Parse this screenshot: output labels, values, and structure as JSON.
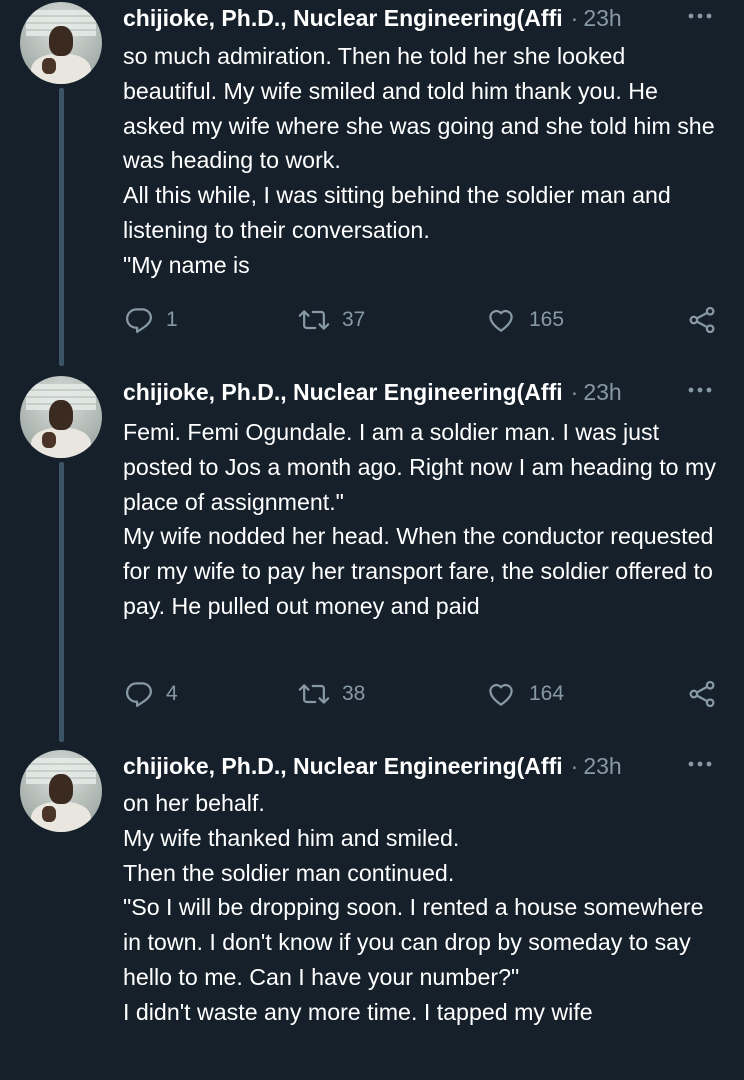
{
  "tweets": [
    {
      "author": "chijioke, Ph.D., Nuclear Engineering(Affi",
      "separator": "·",
      "time": "23h",
      "lines": [
        "so much admiration. Then he told her she looked beautiful. My wife smiled and told him thank you. He asked my wife where she was going and she told him she was heading to work.",
        "All this while, I was sitting behind the soldier man and listening to their conversation.",
        "\"My name is"
      ],
      "replies": "1",
      "retweets": "37",
      "likes": "165"
    },
    {
      "author": "chijioke, Ph.D., Nuclear Engineering(Affi",
      "separator": "·",
      "time": "23h",
      "lines": [
        "Femi. Femi Ogundale. I am a soldier man. I was just posted to Jos a month ago. Right now I am heading to my place of assignment.\"",
        "My wife nodded her head. When the conductor requested for my wife to pay her transport fare, the soldier offered to pay. He pulled out money and paid"
      ],
      "replies": "4",
      "retweets": "38",
      "likes": "164"
    },
    {
      "author": "chijioke, Ph.D., Nuclear Engineering(Affi",
      "separator": "·",
      "time": "23h",
      "lines": [
        "on her behalf.",
        "My wife thanked him and smiled.",
        "Then the soldier man continued.",
        "\"So I will be dropping soon. I rented a house somewhere in town. I don't know if you can drop by someday to say hello to me. Can I have your number?\"",
        "I didn't waste any more time. I tapped my wife"
      ]
    }
  ],
  "icons": {
    "more": "more-options-icon",
    "reply": "reply-icon",
    "retweet": "retweet-icon",
    "like": "heart-icon",
    "share": "share-icon"
  },
  "colors": {
    "background": "#15202b",
    "text": "#ffffff",
    "secondary": "#8899a6",
    "thread_line": "#3d5466"
  }
}
